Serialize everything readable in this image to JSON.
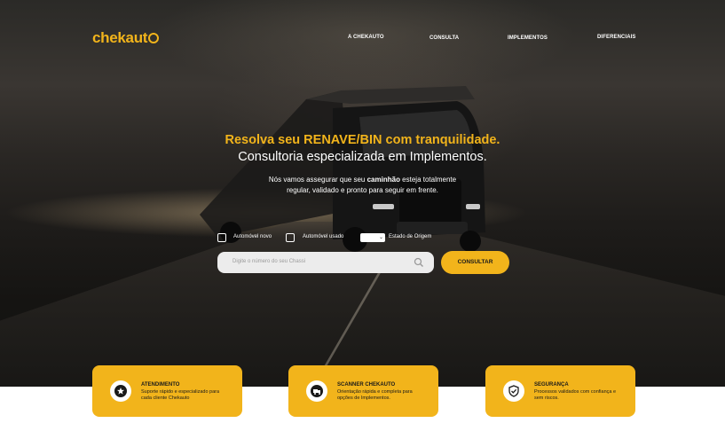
{
  "brand": {
    "logo_text": "chekaut",
    "accent": "#f2b41b"
  },
  "nav": {
    "items": [
      "A CHEKAUTO",
      "CONSULTA",
      "IMPLEMENTOS",
      "DIFERENCIAIS"
    ]
  },
  "hero": {
    "headline_primary": "Resolva seu RENAVE/BIN com tranquilidade.",
    "headline_secondary": "Consultoria especializada em Implementos.",
    "sub_line1_pre": "Nós vamos assegurar que seu ",
    "sub_line1_bold": "caminhão",
    "sub_line1_post": " esteja totalmente",
    "sub_line2": "regular, validado e pronto para seguir em frente."
  },
  "search_form": {
    "option_new": "Automóvel novo",
    "option_used": "Automóvel usado",
    "state_label": "Estado de Origem",
    "state_value": "",
    "input_placeholder": "Digite o número do seu Chassi",
    "submit_label": "CONSULTAR"
  },
  "cards": [
    {
      "title": "ATENDIMENTO",
      "desc": "Suporte rápido e especializado para cada cliente Chekauto",
      "icon": "star-icon"
    },
    {
      "title": "SCANNER CHEKAUTO",
      "desc": "Orientação rápida e completa para opções de Implementos.",
      "icon": "truck-icon"
    },
    {
      "title": "SEGURANÇA",
      "desc": "Processos validados com confiança e sem riscos.",
      "icon": "shield-check-icon"
    }
  ]
}
